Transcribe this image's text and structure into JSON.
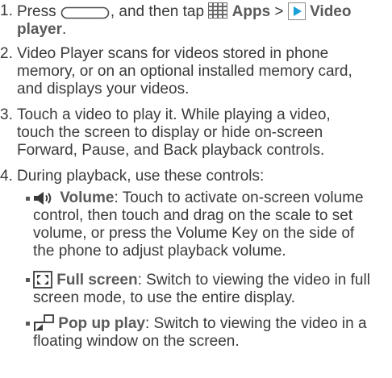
{
  "steps": [
    {
      "number": "1.",
      "text_press": "Press",
      "text_then": ", and then tap",
      "apps_label": "Apps",
      "separator": ">",
      "video_label_line1": "Video",
      "video_label_line2": "player",
      "period": "."
    },
    {
      "number": "2.",
      "lines": [
        "Video Player scans for videos stored in phone",
        "memory, or on an optional installed memory card,",
        "and displays your videos."
      ]
    },
    {
      "number": "3.",
      "lines": [
        "Touch a video to play it. While playing a video,",
        "touch the screen to display or hide on-screen",
        "Forward, Pause, and Back playback controls."
      ]
    },
    {
      "number": "4.",
      "text": "During playback, use these controls:"
    }
  ],
  "controls": [
    {
      "icon": "volume-icon",
      "title": "Volume",
      "lines": [
        ": Touch to activate on-screen volume",
        "control, then touch and drag on the scale to set",
        "volume, or press the Volume Key on the side of",
        "the phone to adjust playback volume."
      ]
    },
    {
      "icon": "full-screen-icon",
      "title": "Full screen",
      "lines": [
        ": Switch to viewing the video in full",
        "screen mode, to use the entire display."
      ]
    },
    {
      "icon": "pop-up-play-icon",
      "title": "Pop up play",
      "lines": [
        ": Switch to viewing the video in a",
        "floating window on the screen."
      ]
    }
  ],
  "colors": {
    "text": "#3a3a3a",
    "bold": "#5a5a5a",
    "video_icon": "#1a9fd8"
  }
}
